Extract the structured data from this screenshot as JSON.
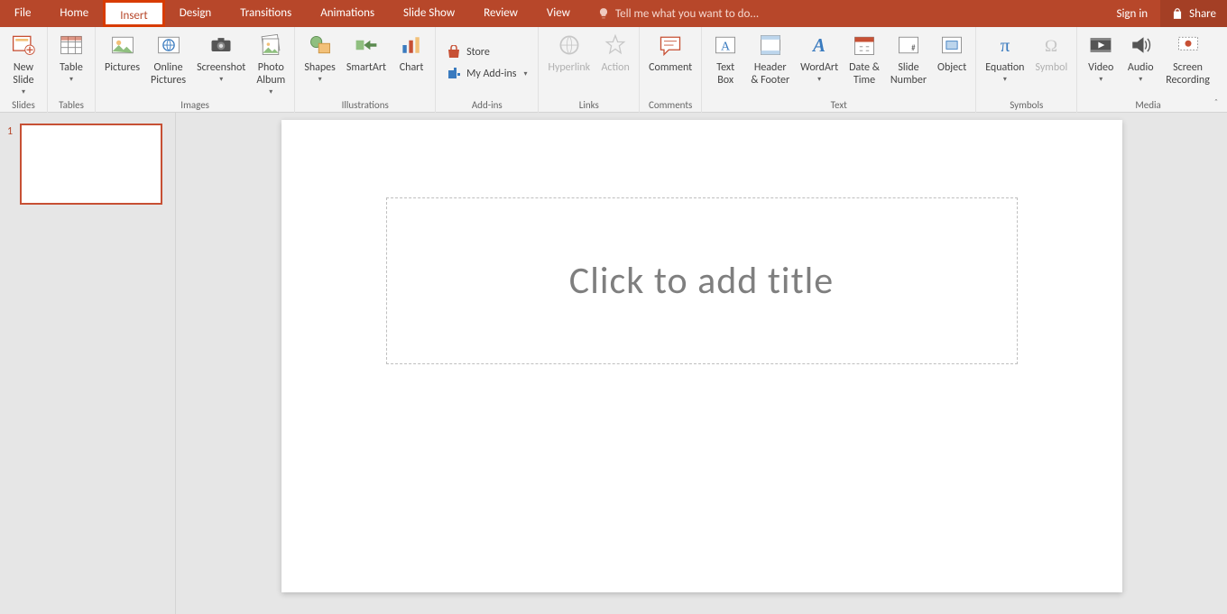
{
  "tabs": [
    "File",
    "Home",
    "Insert",
    "Design",
    "Transitions",
    "Animations",
    "Slide Show",
    "Review",
    "View"
  ],
  "active_tab": "Insert",
  "tellme_placeholder": "Tell me what you want to do...",
  "signin": "Sign in",
  "share": "Share",
  "ribbon": {
    "groups": [
      {
        "label": "Slides",
        "items": [
          {
            "key": "new-slide",
            "label": "New\nSlide",
            "dd": true
          }
        ]
      },
      {
        "label": "Tables",
        "items": [
          {
            "key": "table",
            "label": "Table",
            "dd": true
          }
        ]
      },
      {
        "label": "Images",
        "items": [
          {
            "key": "pictures",
            "label": "Pictures"
          },
          {
            "key": "online-pictures",
            "label": "Online\nPictures"
          },
          {
            "key": "screenshot",
            "label": "Screenshot",
            "dd": true
          },
          {
            "key": "photo-album",
            "label": "Photo\nAlbum",
            "dd": true
          }
        ]
      },
      {
        "label": "Illustrations",
        "items": [
          {
            "key": "shapes",
            "label": "Shapes",
            "dd": true
          },
          {
            "key": "smartart",
            "label": "SmartArt"
          },
          {
            "key": "chart",
            "label": "Chart"
          }
        ]
      },
      {
        "label": "Add-ins",
        "small": [
          {
            "key": "store",
            "label": "Store"
          },
          {
            "key": "my-addins",
            "label": "My Add-ins",
            "dd": true
          }
        ]
      },
      {
        "label": "Links",
        "items": [
          {
            "key": "hyperlink",
            "label": "Hyperlink",
            "disabled": true
          },
          {
            "key": "action",
            "label": "Action",
            "disabled": true
          }
        ]
      },
      {
        "label": "Comments",
        "items": [
          {
            "key": "comment",
            "label": "Comment"
          }
        ]
      },
      {
        "label": "Text",
        "items": [
          {
            "key": "textbox",
            "label": "Text\nBox"
          },
          {
            "key": "header-footer",
            "label": "Header\n& Footer"
          },
          {
            "key": "wordart",
            "label": "WordArt",
            "dd": true
          },
          {
            "key": "date-time",
            "label": "Date &\nTime"
          },
          {
            "key": "slide-number",
            "label": "Slide\nNumber"
          },
          {
            "key": "object",
            "label": "Object"
          }
        ]
      },
      {
        "label": "Symbols",
        "items": [
          {
            "key": "equation",
            "label": "Equation",
            "dd": true
          },
          {
            "key": "symbol",
            "label": "Symbol",
            "disabled": true
          }
        ]
      },
      {
        "label": "Media",
        "items": [
          {
            "key": "video",
            "label": "Video",
            "dd": true
          },
          {
            "key": "audio",
            "label": "Audio",
            "dd": true
          },
          {
            "key": "screen-recording",
            "label": "Screen\nRecording"
          }
        ]
      }
    ]
  },
  "thumb_number": "1",
  "title_placeholder": "Click to add title"
}
